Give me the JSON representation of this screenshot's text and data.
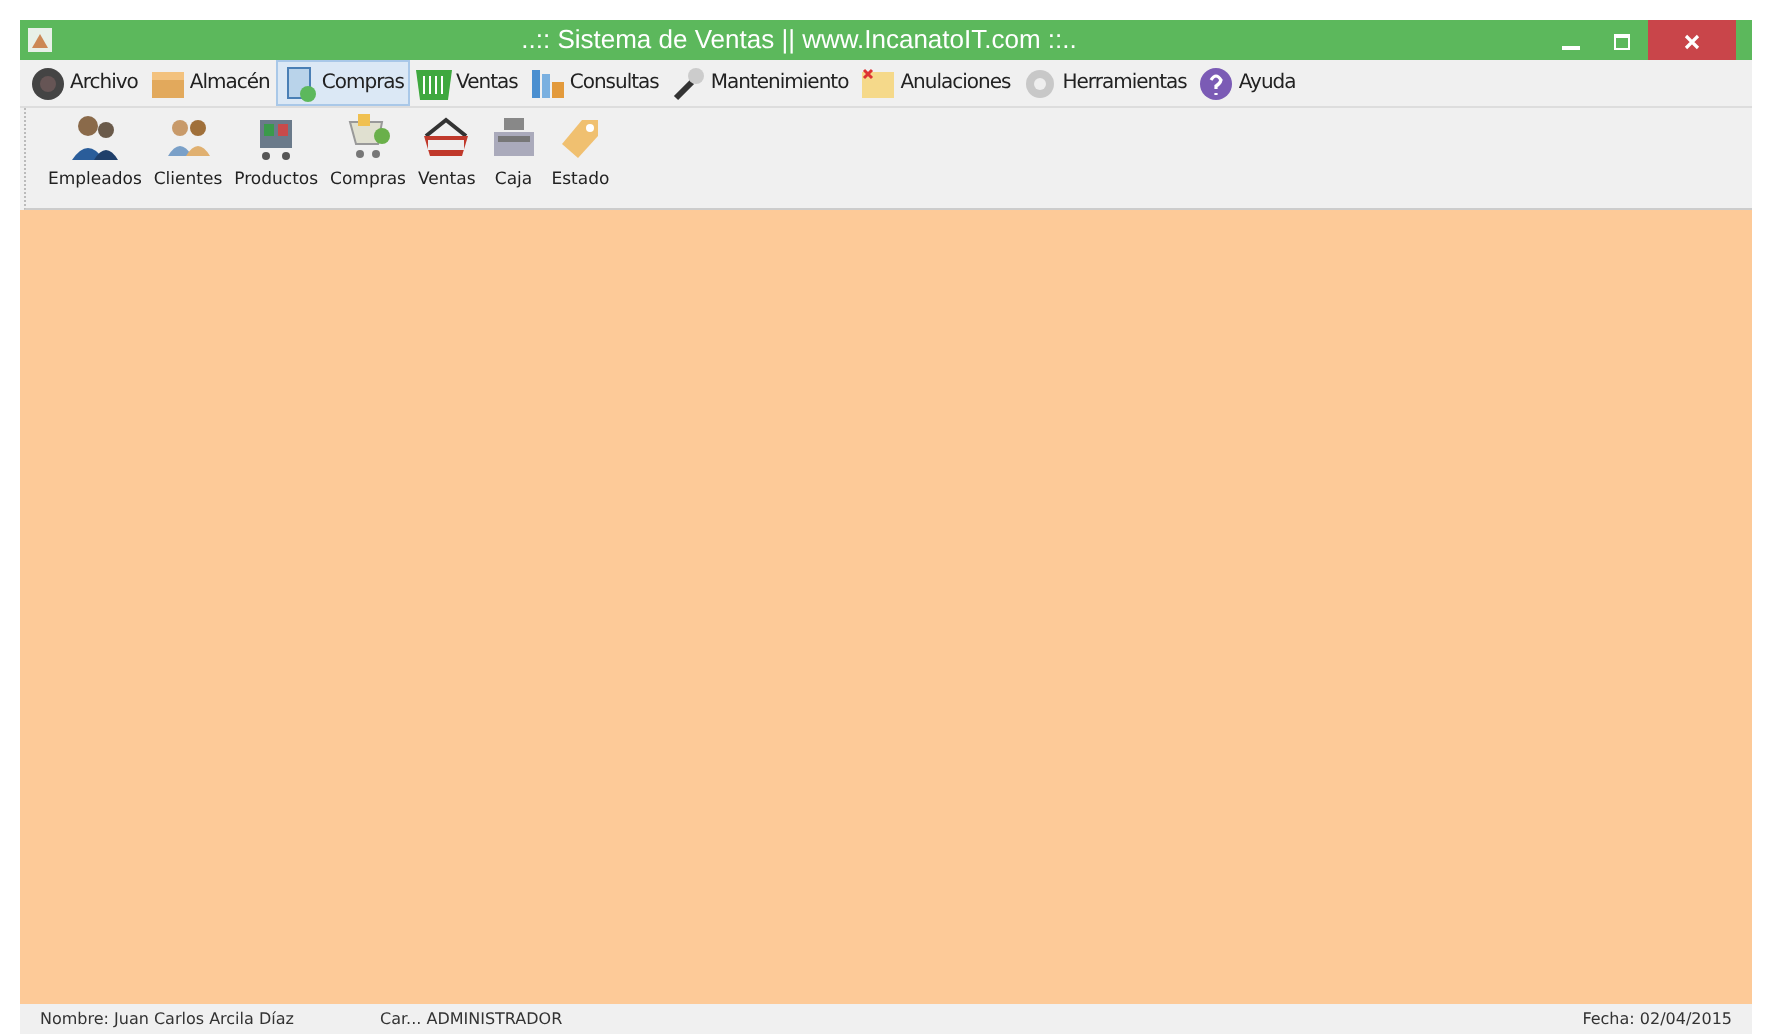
{
  "window": {
    "title": "..:: Sistema de Ventas || www.IncanatoIT.com ::.."
  },
  "menu": [
    {
      "label": "Archivo",
      "selected": false
    },
    {
      "label": "Almacén",
      "selected": false
    },
    {
      "label": "Compras",
      "selected": true
    },
    {
      "label": "Ventas",
      "selected": false
    },
    {
      "label": "Consultas",
      "selected": false
    },
    {
      "label": "Mantenimiento",
      "selected": false
    },
    {
      "label": "Anulaciones",
      "selected": false
    },
    {
      "label": "Herramientas",
      "selected": false
    },
    {
      "label": "Ayuda",
      "selected": false
    }
  ],
  "toolbar": [
    "Empleados",
    "Clientes",
    "Productos",
    "Compras",
    "Ventas",
    "Caja",
    "Estado"
  ],
  "status_bar": {
    "user": "Nombre:  Juan Carlos Arcila Díaz",
    "role": "Car...  ADMINISTRADOR",
    "date": "Fecha:  02/04/2015"
  }
}
